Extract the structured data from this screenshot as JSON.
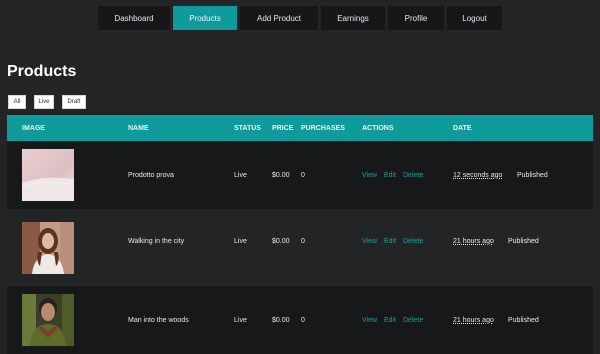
{
  "nav": [
    {
      "label": "Dashboard",
      "active": false
    },
    {
      "label": "Products",
      "active": true
    },
    {
      "label": "Add Product",
      "active": false
    },
    {
      "label": "Earnings",
      "active": false
    },
    {
      "label": "Profile",
      "active": false
    },
    {
      "label": "Logout",
      "active": false
    }
  ],
  "page_title": "Products",
  "filters": [
    "All",
    "Live",
    "Draft"
  ],
  "table": {
    "headers": {
      "image": "IMAGE",
      "name": "NAME",
      "status": "STATUS",
      "price": "PRICE",
      "purchases": "PURCHASES",
      "actions": "ACTIONS",
      "date": "DATE"
    },
    "rows": [
      {
        "name": "Prodotto prova",
        "status": "Live",
        "price": "$0.00",
        "purchases": "0",
        "view": "View",
        "edit": "Edit",
        "delete": "Delete",
        "date": "12 seconds ago",
        "state": "Published",
        "thumb_icon": "pink-fabric-photo"
      },
      {
        "name": "Walking in the city",
        "status": "Live",
        "price": "$0.00",
        "purchases": "0",
        "view": "View",
        "edit": "Edit",
        "delete": "Delete",
        "date": "21 hours ago",
        "state": "Published",
        "thumb_icon": "woman-portrait-photo"
      },
      {
        "name": "Man into the woods",
        "status": "Live",
        "price": "$0.00",
        "purchases": "0",
        "view": "View",
        "edit": "Edit",
        "delete": "Delete",
        "date": "21 hours ago",
        "state": "Published",
        "thumb_icon": "man-portrait-photo"
      }
    ]
  },
  "colors": {
    "accent": "#0f9a9b",
    "link": "#169fa1",
    "background": "#232426",
    "nav_bg": "#161718"
  }
}
